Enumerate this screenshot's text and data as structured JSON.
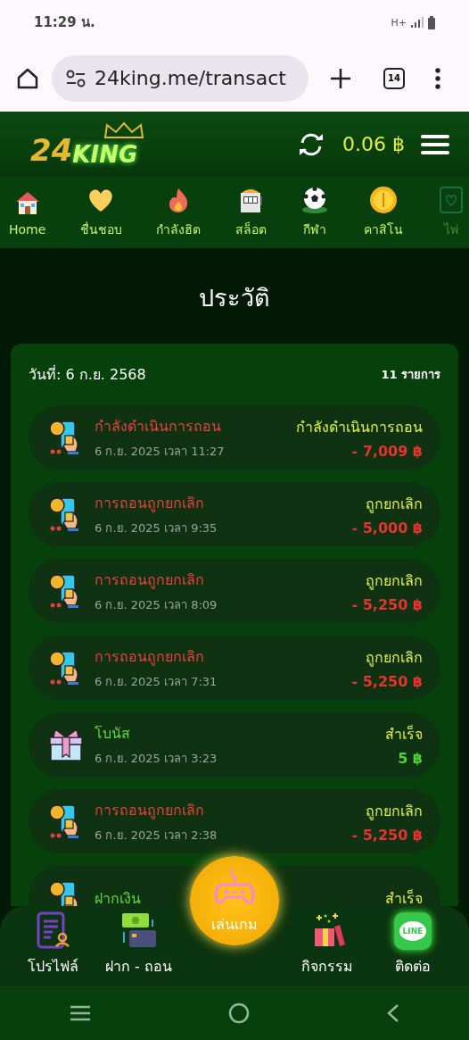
{
  "status_bar": {
    "time": "11:29 น.",
    "network": "H+"
  },
  "browser": {
    "url": "24king.me/transact",
    "tab_count": "14"
  },
  "header": {
    "logo_number": "24",
    "logo_word": "KING",
    "balance": "0.06 ฿"
  },
  "categories": [
    {
      "label": "Home",
      "kind": "home",
      "dimmed": false
    },
    {
      "label": "ชื่นชอบ",
      "kind": "heart",
      "dimmed": false
    },
    {
      "label": "กำลังฮิต",
      "kind": "fire",
      "dimmed": false
    },
    {
      "label": "สล็อต",
      "kind": "slot",
      "dimmed": false
    },
    {
      "label": "กีฬา",
      "kind": "ball",
      "dimmed": false
    },
    {
      "label": "คาสิโน",
      "kind": "coin",
      "dimmed": false
    },
    {
      "label": "ไพ่",
      "kind": "card",
      "dimmed": true
    }
  ],
  "page_title": "ประวัติ",
  "history": {
    "date": "วันที่: 6 ก.ย. 2568",
    "count": "11 รายการ",
    "rows": [
      {
        "kind": "withdraw",
        "title": "กำลังดำเนินการถอน",
        "time": "6 ก.ย. 2025 เวลา 11:27",
        "status": "กำลังดำเนินการถอน",
        "amount": "- 7,009 ฿"
      },
      {
        "kind": "withdraw",
        "title": "การถอนถูกยกเลิก",
        "time": "6 ก.ย. 2025 เวลา 9:35",
        "status": "ถูกยกเลิก",
        "amount": "- 5,000 ฿"
      },
      {
        "kind": "withdraw",
        "title": "การถอนถูกยกเลิก",
        "time": "6 ก.ย. 2025 เวลา 8:09",
        "status": "ถูกยกเลิก",
        "amount": "- 5,250 ฿"
      },
      {
        "kind": "withdraw",
        "title": "การถอนถูกยกเลิก",
        "time": "6 ก.ย. 2025 เวลา 7:31",
        "status": "ถูกยกเลิก",
        "amount": "- 5,250 ฿"
      },
      {
        "kind": "bonus",
        "title": "โบนัส",
        "time": "6 ก.ย. 2025 เวลา 3:23",
        "status": "สำเร็จ",
        "amount": "5 ฿"
      },
      {
        "kind": "withdraw",
        "title": "การถอนถูกยกเลิก",
        "time": "6 ก.ย. 2025 เวลา 2:38",
        "status": "ถูกยกเลิก",
        "amount": "- 5,250 ฿"
      },
      {
        "kind": "deposit",
        "title": "ฝากเงิน",
        "status": "สำเร็จ"
      }
    ]
  },
  "bottom_nav": [
    {
      "label": "โปรไฟล์",
      "kind": "profile"
    },
    {
      "label": "ฝาก - ถอน",
      "kind": "transfer"
    },
    {
      "label": "เล่นเกม",
      "kind": "play"
    },
    {
      "label": "กิจกรรม",
      "kind": "event"
    },
    {
      "label": "ติดต่อ",
      "kind": "line",
      "badge": "LINE"
    }
  ]
}
